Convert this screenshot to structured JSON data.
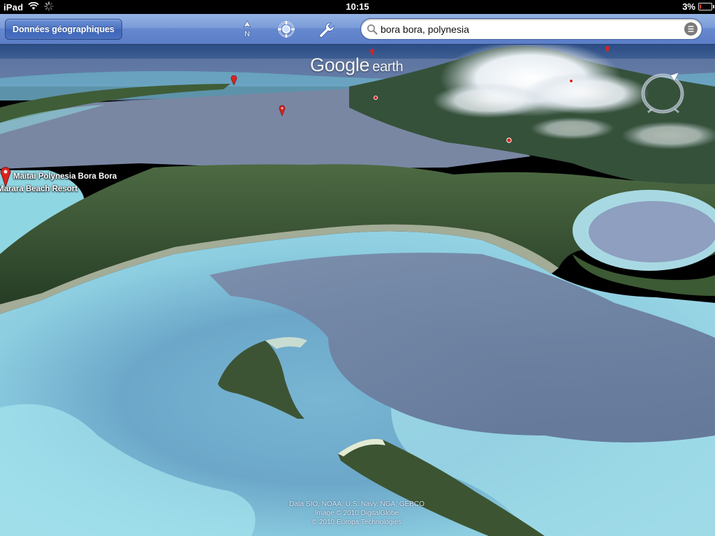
{
  "statusbar": {
    "device": "iPad",
    "time": "10:15",
    "battery": "3%",
    "battery_level": 0.03,
    "icons": [
      "wifi-icon",
      "activity-spinner-icon",
      "battery-icon"
    ]
  },
  "toolbar": {
    "layers_button": "Données géographiques",
    "north_label": "N",
    "icons": [
      "north-arrow-icon",
      "my-location-icon",
      "settings-wrench-icon"
    ]
  },
  "search": {
    "query": "bora bora, polynesia",
    "icons": [
      "search-icon",
      "search-results-list-icon"
    ]
  },
  "map": {
    "logo_google": "Google",
    "logo_earth": "earth",
    "placemark_line1": "Maitai Polynesia Bora Bora",
    "placemark_line2": "Marara Beach Resort",
    "attribution": [
      "Data SIO, NOAA, U.S. Navy, NGA, GEBCO",
      "Image © 2010 DigitalGlobe",
      "© 2010 Europa Technologies"
    ],
    "pin_color": "#d8241f",
    "icons": [
      "placemark-pin-icon",
      "compass-tilt-control-icon"
    ]
  },
  "colors": {
    "toolbar": "#6688cf",
    "lagoon_light": "#8fd3e4",
    "lagoon_deep": "#5a6e92",
    "island_green": "#3c5a34"
  }
}
